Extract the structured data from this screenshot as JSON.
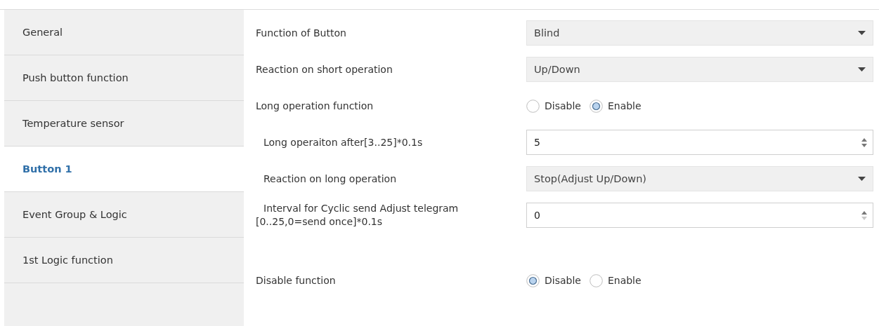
{
  "sidebar": {
    "items": [
      {
        "label": "General",
        "selected": false
      },
      {
        "label": "Push button function",
        "selected": false
      },
      {
        "label": "Temperature sensor",
        "selected": false
      },
      {
        "label": "Button 1",
        "selected": true
      },
      {
        "label": "Event Group & Logic",
        "selected": false
      },
      {
        "label": "1st Logic function",
        "selected": false
      }
    ]
  },
  "parameters": [
    {
      "label": "Function of Button",
      "indented": false,
      "spaced": false,
      "kind": "dropdown",
      "value": "Blind"
    },
    {
      "label": "Reaction on short operation",
      "indented": false,
      "spaced": false,
      "kind": "dropdown",
      "value": "Up/Down"
    },
    {
      "label": "Long operation function",
      "indented": false,
      "spaced": false,
      "kind": "radio",
      "options": [
        {
          "label": "Disable",
          "selected": false
        },
        {
          "label": "Enable",
          "selected": true
        }
      ]
    },
    {
      "label": "Long operaiton after[3..25]*0.1s",
      "indented": true,
      "spaced": false,
      "kind": "spinner",
      "value": "5",
      "down_disabled": false
    },
    {
      "label": "Reaction on long operation",
      "indented": true,
      "spaced": false,
      "kind": "dropdown",
      "value": "Stop(Adjust Up/Down)"
    },
    {
      "label": "Interval for Cyclic send Adjust telegram\n[0..25,0=send once]*0.1s",
      "indented": true,
      "spaced": false,
      "kind": "spinner",
      "value": "0",
      "down_disabled": true
    },
    {
      "label": "Disable function",
      "indented": false,
      "spaced": true,
      "kind": "radio",
      "options": [
        {
          "label": "Disable",
          "selected": true
        },
        {
          "label": "Enable",
          "selected": false
        }
      ]
    }
  ]
}
